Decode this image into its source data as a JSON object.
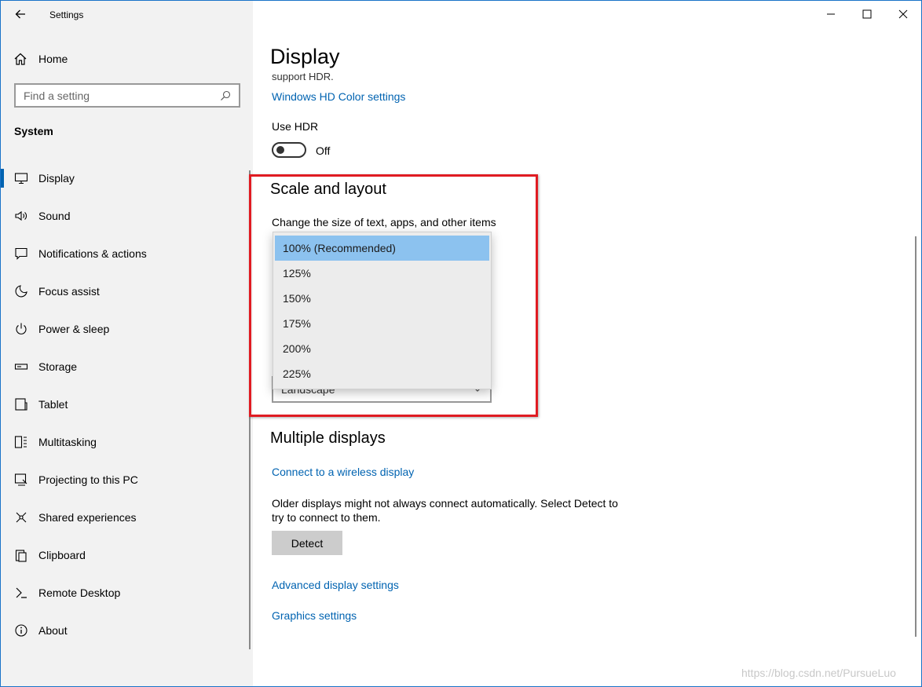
{
  "window": {
    "title": "Settings"
  },
  "sidebar": {
    "home_label": "Home",
    "search_placeholder": "Find a setting",
    "section": "System",
    "items": [
      {
        "label": "Display",
        "icon": "monitor-icon",
        "active": true
      },
      {
        "label": "Sound",
        "icon": "speaker-icon"
      },
      {
        "label": "Notifications & actions",
        "icon": "message-icon"
      },
      {
        "label": "Focus assist",
        "icon": "moon-icon"
      },
      {
        "label": "Power & sleep",
        "icon": "power-icon"
      },
      {
        "label": "Storage",
        "icon": "storage-icon"
      },
      {
        "label": "Tablet",
        "icon": "tablet-icon"
      },
      {
        "label": "Multitasking",
        "icon": "multitasking-icon"
      },
      {
        "label": "Projecting to this PC",
        "icon": "projector-icon"
      },
      {
        "label": "Shared experiences",
        "icon": "share-icon"
      },
      {
        "label": "Clipboard",
        "icon": "clipboard-icon"
      },
      {
        "label": "Remote Desktop",
        "icon": "remote-icon"
      },
      {
        "label": "About",
        "icon": "info-icon"
      }
    ]
  },
  "main": {
    "title": "Display",
    "cut_text": "support HDR.",
    "hdr_link": "Windows HD Color settings",
    "use_hdr_label": "Use HDR",
    "use_hdr_state": "Off",
    "scale_heading": "Scale and layout",
    "change_size_label": "Change the size of text, apps, and other items",
    "scale_options": [
      "100% (Recommended)",
      "125%",
      "150%",
      "175%",
      "200%",
      "225%"
    ],
    "selected_scale": "100% (Recommended)",
    "orientation_value": "Landscape",
    "multiple_heading": "Multiple displays",
    "wireless_link": "Connect to a wireless display",
    "older_text": "Older displays might not always connect automatically. Select Detect to try to connect to them.",
    "detect_label": "Detect",
    "advanced_link": "Advanced display settings",
    "graphics_link": "Graphics settings"
  },
  "watermark": "https://blog.csdn.net/PursueLuo",
  "colors": {
    "accent": "#0063b1",
    "link": "#0063b1",
    "highlight_box": "#e01b22",
    "dropdown_selected": "#8cc2ef"
  }
}
